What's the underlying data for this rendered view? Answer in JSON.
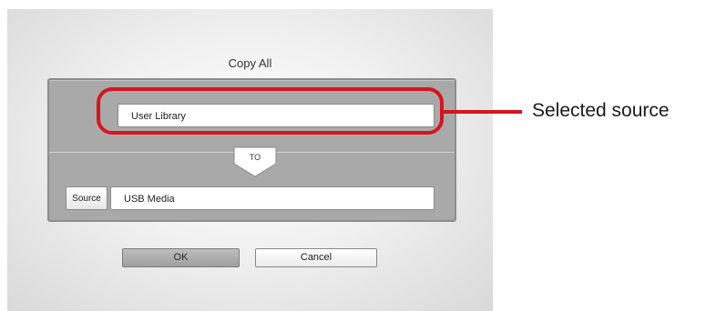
{
  "dialog": {
    "title": "Copy All",
    "source_field_value": "User Library",
    "connector_label": "TO",
    "source_button_label": "Source",
    "destination_field_value": "USB Media",
    "ok_label": "OK",
    "cancel_label": "Cancel"
  },
  "annotation": {
    "callout_text": "Selected source",
    "color": "#d7141d"
  },
  "icons": {
    "connector": "down-arrow-tab-icon"
  }
}
